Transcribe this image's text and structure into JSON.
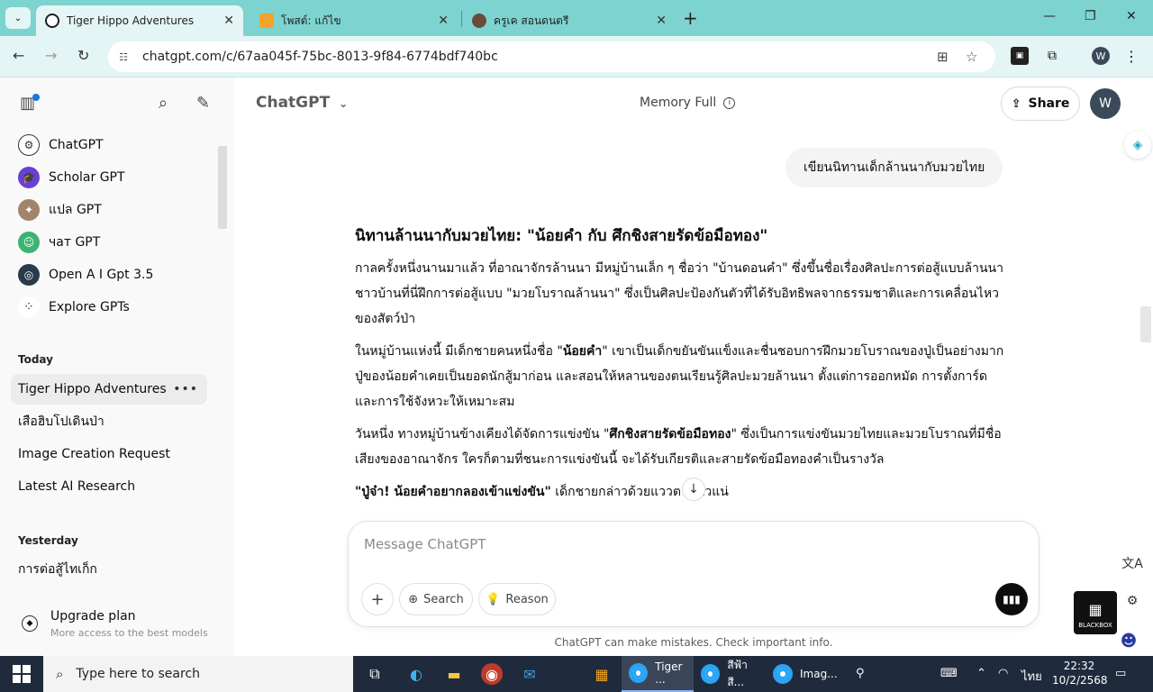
{
  "browser": {
    "tabs": [
      {
        "title": "Tiger Hippo Adventures",
        "favicon_color": "#1f1f1f"
      },
      {
        "title": "โพสต์: แก้ไข",
        "favicon_color": "#f4a229"
      },
      {
        "title": "ครูเค สอนดนตรี",
        "favicon_color": "#6b4a3a"
      }
    ],
    "url": "chatgpt.com/c/67aa045f-75bc-8013-9f84-6774bdf740bc",
    "profile_initial": "W"
  },
  "sidebar": {
    "gpts": [
      {
        "label": "ChatGPT",
        "icon": "openai-logo-icon",
        "color": "#ffffff"
      },
      {
        "label": "Scholar GPT",
        "icon": "graduation-cap-icon",
        "color": "#6a3fd6"
      },
      {
        "label": "แปล GPT",
        "icon": "translate-avatar-icon",
        "color": "#a0856a"
      },
      {
        "label": "чат GPT",
        "icon": "chat-robot-icon",
        "color": "#3cb371"
      },
      {
        "label": "Open A I Gpt 3.5",
        "icon": "globe-avatar-icon",
        "color": "#2a3a4a"
      },
      {
        "label": "Explore GPTs",
        "icon": "grid-icon",
        "color": "#ffffff"
      }
    ],
    "today_label": "Today",
    "today_chats": [
      "Tiger Hippo Adventures",
      "เสือฮิบโปเดินป่า",
      "Image Creation Request",
      "Latest AI Research"
    ],
    "yesterday_label": "Yesterday",
    "yesterday_chats": [
      "การต่อสู้ไทเก็ก"
    ],
    "upgrade": {
      "title": "Upgrade plan",
      "subtitle": "More access to the best models"
    }
  },
  "header": {
    "model": "ChatGPT",
    "memory": "Memory Full",
    "share": "Share",
    "avatar": "W"
  },
  "conversation": {
    "user_message": "เขียนนิทานเด็กล้านนากับมวยไทย",
    "title": "นิทานล้านนากับมวยไทย: \"น้อยคำ กับ ศึกชิงสายรัดข้อมือทอง\"",
    "p1": "กาลครั้งหนึ่งนานมาแล้ว ที่อาณาจักรล้านนา มีหมู่บ้านเล็ก ๆ ชื่อว่า \"บ้านดอนคำ\" ซึ่งขึ้นชื่อเรื่องศิลปะการต่อสู้แบบล้านนา ชาวบ้านที่นี่ฝึกการต่อสู้แบบ \"มวยโบราณล้านนา\" ซึ่งเป็นศิลปะป้องกันตัวที่ได้รับอิทธิพลจากธรรมชาติและการเคลื่อนไหวของสัตว์ป่า",
    "p2_pre": "ในหมู่บ้านแห่งนี้ มีเด็กชายคนหนึ่งชื่อ \"",
    "p2_bold": "น้อยคำ",
    "p2_post": "\" เขาเป็นเด็กขยันขันแข็งและชื่นชอบการฝึกมวยโบราณของปู่เป็นอย่างมาก ปู่ของน้อยคำเคยเป็นยอดนักสู้มาก่อน และสอนให้หลานของตนเรียนรู้ศิลปะมวยล้านนา ตั้งแต่การออกหมัด การตั้งการ์ด และการใช้จังหวะให้เหมาะสม",
    "p3_pre": "วันหนึ่ง ทางหมู่บ้านข้างเคียงได้จัดการแข่งขัน \"",
    "p3_bold": "ศึกชิงสายรัดข้อมือทอง",
    "p3_post": "\" ซึ่งเป็นการแข่งขันมวยไทยและมวยโบราณที่มีชื่อเสียงของอาณาจักร ใครก็ตามที่ชนะการแข่งขันนี้ จะได้รับเกียรติและสายรัดข้อมือทองคำเป็นรางวัล",
    "p4_bold": "\"ปู่จ๋า! น้อยคำอยากลองเข้าแข่งขัน\"",
    "p4_post": " เด็กชายกล่าวด้วยแววตาแน่วแน่"
  },
  "composer": {
    "placeholder": "Message ChatGPT",
    "search": "Search",
    "reason": "Reason"
  },
  "disclaimer": "ChatGPT can make mistakes. Check important info.",
  "extensions": {
    "blackbox": "BLACKBOX"
  },
  "taskbar": {
    "search_placeholder": "Type here to search",
    "chrome_windows": [
      "Tiger ...",
      "สีฟ้า สี...",
      "Imag..."
    ],
    "language": "ไทย",
    "time": "22:32",
    "date": "10/2/2568"
  }
}
